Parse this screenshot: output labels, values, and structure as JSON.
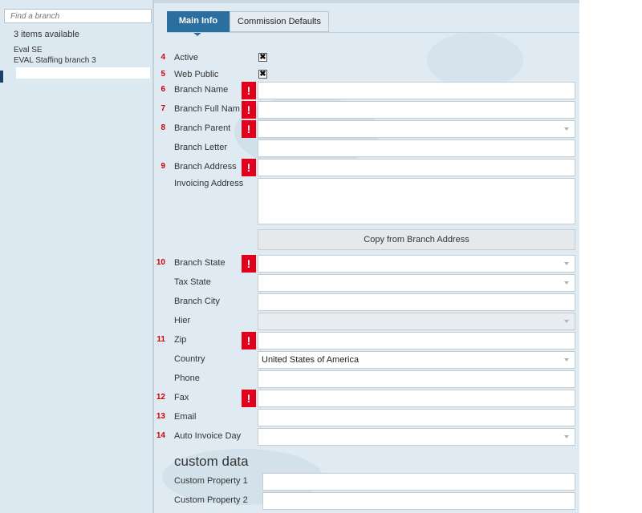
{
  "left_panel": {
    "search": {
      "placeholder": "Find a branch",
      "value": ""
    },
    "count_text": "3 items available",
    "items": [
      "Eval SE",
      "EVAL Staffing branch 3"
    ]
  },
  "tabs": [
    {
      "label": "Main Info",
      "active": true
    },
    {
      "label": "Commission Defaults",
      "active": false
    }
  ],
  "fields": {
    "active": {
      "num": "4",
      "label": "Active",
      "checked": true,
      "check_glyph": "✖"
    },
    "web_public": {
      "num": "5",
      "label": "Web Public",
      "checked": true,
      "check_glyph": "✖"
    },
    "branch_name": {
      "num": "6",
      "label": "Branch Name",
      "value": "",
      "required": true
    },
    "branch_full_name": {
      "num": "7",
      "label": "Branch Full Nam",
      "value": "",
      "required": true
    },
    "branch_parent": {
      "num": "8",
      "label": "Branch Parent",
      "value": "",
      "required": true
    },
    "branch_letter": {
      "num": "",
      "label": "Branch Letter",
      "value": ""
    },
    "branch_address": {
      "num": "9",
      "label": "Branch Address",
      "value": "",
      "required": true
    },
    "invoicing_address": {
      "num": "",
      "label": "Invoicing Address",
      "value": ""
    },
    "copy_button": "Copy from Branch Address",
    "branch_state": {
      "num": "10",
      "label": "Branch State",
      "value": "",
      "required": true
    },
    "tax_state": {
      "num": "",
      "label": "Tax State",
      "value": ""
    },
    "branch_city": {
      "num": "",
      "label": "Branch City",
      "value": ""
    },
    "hier": {
      "num": "",
      "label": "Hier",
      "value": ""
    },
    "zip": {
      "num": "11",
      "label": "Zip",
      "value": "",
      "required": true
    },
    "country": {
      "num": "",
      "label": "Country",
      "value": "United States of America"
    },
    "phone": {
      "num": "",
      "label": "Phone",
      "value": ""
    },
    "fax": {
      "num": "12",
      "label": "Fax",
      "value": "",
      "required": true
    },
    "email": {
      "num": "13",
      "label": "Email",
      "value": ""
    },
    "auto_invoice_day": {
      "num": "14",
      "label": "Auto Invoice Day",
      "value": ""
    }
  },
  "required_glyph": "!",
  "custom_data": {
    "heading": "custom data",
    "properties": [
      {
        "label": "Custom Property 1",
        "value": ""
      },
      {
        "label": "Custom Property 2",
        "value": ""
      }
    ]
  },
  "colors": {
    "accent": "#2a6fa0",
    "required": "#e2001a",
    "number": "#d20000"
  }
}
